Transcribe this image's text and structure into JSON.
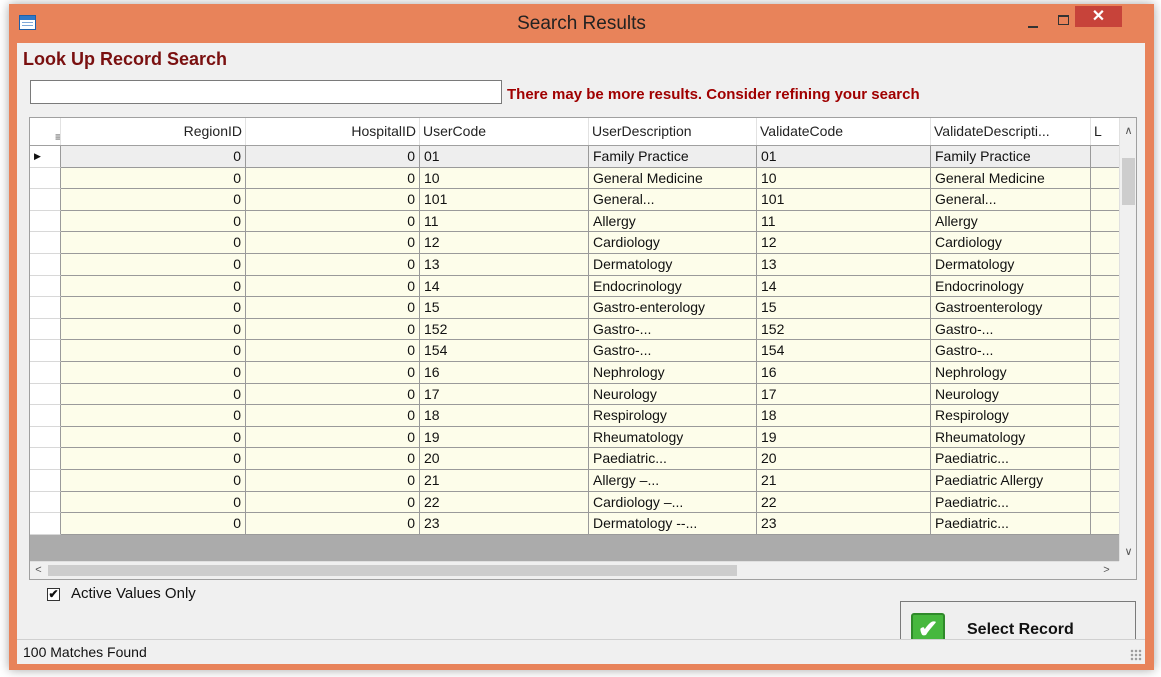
{
  "window": {
    "title": "Search Results",
    "close_glyph": "✕",
    "buttons": [
      "minimize-icon",
      "maximize-icon",
      "close-icon"
    ]
  },
  "heading": "Look Up Record Search",
  "search": {
    "value": "",
    "placeholder": ""
  },
  "warning": "There may be more results. Consider refining your search",
  "grid": {
    "corner_glyph": "≡",
    "columns": [
      "RegionID",
      "HospitalID",
      "UserCode",
      "UserDescription",
      "ValidateCode",
      "ValidateDescripti...",
      "L"
    ],
    "selected_row_indicator": "▶",
    "rows": [
      [
        "0",
        "0",
        "01",
        "Family Practice",
        "01",
        "Family Practice"
      ],
      [
        "0",
        "0",
        "10",
        "General Medicine",
        "10",
        "General Medicine"
      ],
      [
        "0",
        "0",
        "101",
        "General...",
        "101",
        "General..."
      ],
      [
        "0",
        "0",
        "11",
        "Allergy",
        "11",
        "Allergy"
      ],
      [
        "0",
        "0",
        "12",
        "Cardiology",
        "12",
        "Cardiology"
      ],
      [
        "0",
        "0",
        "13",
        "Dermatology",
        "13",
        "Dermatology"
      ],
      [
        "0",
        "0",
        "14",
        "Endocrinology",
        "14",
        "Endocrinology"
      ],
      [
        "0",
        "0",
        "15",
        "Gastro-enterology",
        "15",
        "Gastroenterology"
      ],
      [
        "0",
        "0",
        "152",
        "Gastro-...",
        "152",
        "Gastro-..."
      ],
      [
        "0",
        "0",
        "154",
        "Gastro-...",
        "154",
        "Gastro-..."
      ],
      [
        "0",
        "0",
        "16",
        "Nephrology",
        "16",
        "Nephrology"
      ],
      [
        "0",
        "0",
        "17",
        "Neurology",
        "17",
        "Neurology"
      ],
      [
        "0",
        "0",
        "18",
        "Respirology",
        "18",
        "Respirology"
      ],
      [
        "0",
        "0",
        "19",
        "Rheumatology",
        "19",
        "Rheumatology"
      ],
      [
        "0",
        "0",
        "20",
        "Paediatric...",
        "20",
        "Paediatric..."
      ],
      [
        "0",
        "0",
        "21",
        "Allergy –...",
        "21",
        "Paediatric Allergy"
      ],
      [
        "0",
        "0",
        "22",
        "Cardiology –...",
        "22",
        "Paediatric..."
      ],
      [
        "0",
        "0",
        "23",
        "Dermatology --...",
        "23",
        "Paediatric..."
      ]
    ],
    "scroll_glyphs": {
      "up": "∧",
      "down": "∨",
      "left": "<",
      "right": ">"
    }
  },
  "active_values": {
    "label": "Active Values Only",
    "checked": true,
    "glyph": "✔"
  },
  "select_button": {
    "label": "Select Record",
    "icon": "check-icon",
    "glyph": "✔"
  },
  "status": "100 Matches Found",
  "colors": {
    "frame": "#e8835a",
    "row_bg": "#fdfdea",
    "heading": "#7a1010",
    "warning": "#a00000",
    "close": "#c7433a",
    "accept": "#47b83e"
  }
}
